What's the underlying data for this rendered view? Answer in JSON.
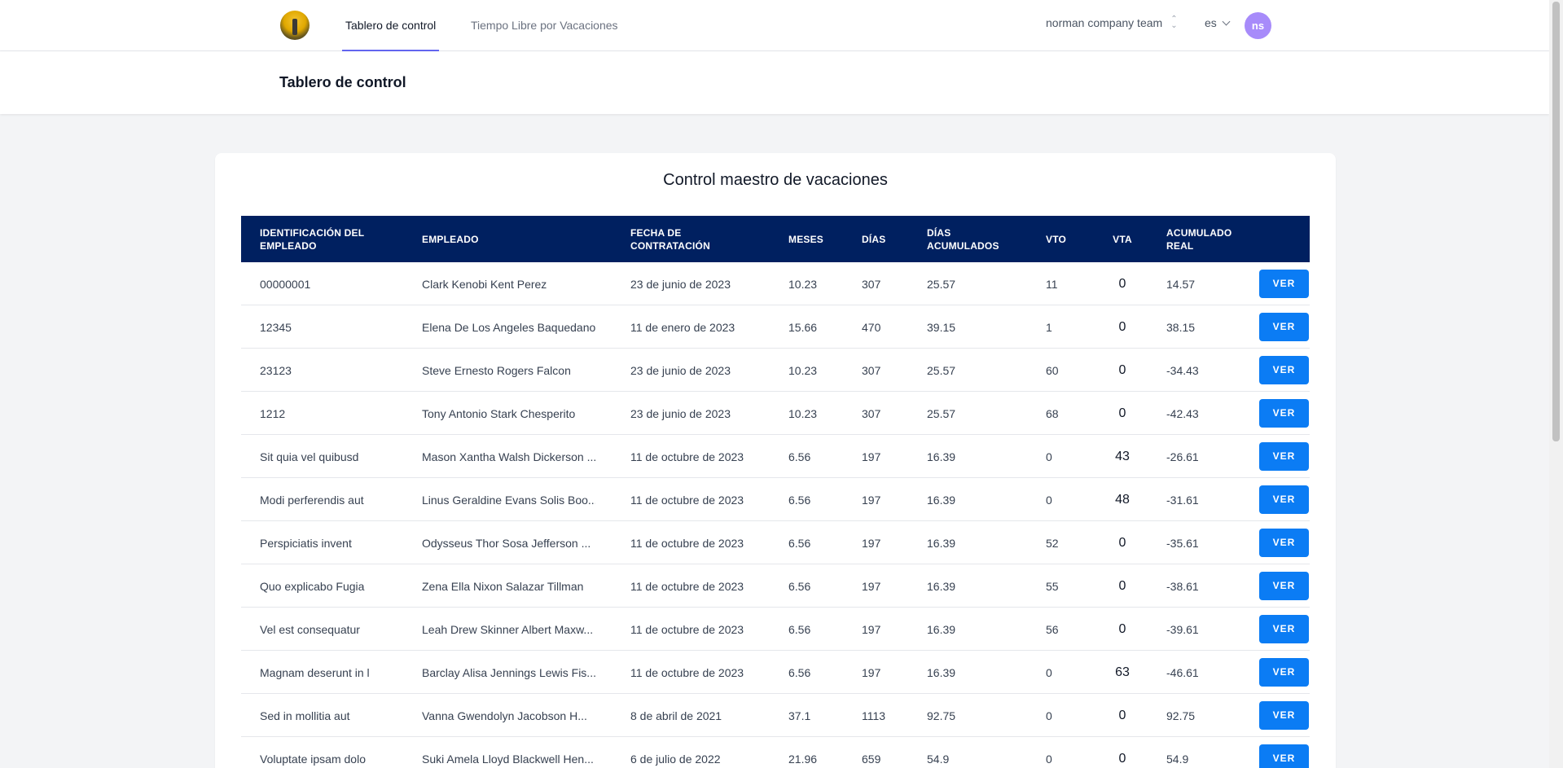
{
  "nav": {
    "tabs": [
      {
        "label": "Tablero de control",
        "active": true
      },
      {
        "label": "Tiempo Libre por Vacaciones",
        "active": false
      }
    ],
    "team": "norman company team",
    "lang": "es",
    "avatar_initials": "ns"
  },
  "header": {
    "title": "Tablero de control"
  },
  "card": {
    "title": "Control maestro de vacaciones"
  },
  "table": {
    "columns": {
      "id": "IDENTIFICACIÓN DEL EMPLEADO",
      "employee": "EMPLEADO",
      "hire_date": "FECHA DE CONTRATACIÓN",
      "months": "MESES",
      "days": "DÍAS",
      "accrued_days": "DÍAS ACUMULADOS",
      "vto": "VTO",
      "vta": "VTA",
      "real_accrued": "ACUMULADO REAL"
    },
    "action_label": "VER",
    "rows": [
      {
        "id": "00000001",
        "employee": "Clark Kenobi Kent Perez",
        "hire_date": "23 de junio de 2023",
        "months": "10.23",
        "days": "307",
        "accrued": "25.57",
        "vto": "11",
        "vta": "0",
        "real": "14.57"
      },
      {
        "id": "12345",
        "employee": "Elena De Los Angeles Baquedano",
        "hire_date": "11 de enero de 2023",
        "months": "15.66",
        "days": "470",
        "accrued": "39.15",
        "vto": "1",
        "vta": "0",
        "real": "38.15"
      },
      {
        "id": "23123",
        "employee": "Steve Ernesto Rogers Falcon",
        "hire_date": "23 de junio de 2023",
        "months": "10.23",
        "days": "307",
        "accrued": "25.57",
        "vto": "60",
        "vta": "0",
        "real": "-34.43"
      },
      {
        "id": "1212",
        "employee": "Tony Antonio Stark Chesperito",
        "hire_date": "23 de junio de 2023",
        "months": "10.23",
        "days": "307",
        "accrued": "25.57",
        "vto": "68",
        "vta": "0",
        "real": "-42.43"
      },
      {
        "id": "Sit quia vel quibusd",
        "employee": "Mason Xantha Walsh Dickerson ...",
        "hire_date": "11 de octubre de 2023",
        "months": "6.56",
        "days": "197",
        "accrued": "16.39",
        "vto": "0",
        "vta": "43",
        "real": "-26.61"
      },
      {
        "id": "Modi perferendis aut",
        "employee": "Linus Geraldine Evans Solis Boo...",
        "hire_date": "11 de octubre de 2023",
        "months": "6.56",
        "days": "197",
        "accrued": "16.39",
        "vto": "0",
        "vta": "48",
        "real": "-31.61"
      },
      {
        "id": "Perspiciatis invent",
        "employee": "Odysseus Thor Sosa Jefferson ...",
        "hire_date": "11 de octubre de 2023",
        "months": "6.56",
        "days": "197",
        "accrued": "16.39",
        "vto": "52",
        "vta": "0",
        "real": "-35.61"
      },
      {
        "id": "Quo explicabo Fugia",
        "employee": "Zena Ella Nixon Salazar Tillman",
        "hire_date": "11 de octubre de 2023",
        "months": "6.56",
        "days": "197",
        "accrued": "16.39",
        "vto": "55",
        "vta": "0",
        "real": "-38.61"
      },
      {
        "id": "Vel est consequatur",
        "employee": "Leah Drew Skinner Albert Maxw...",
        "hire_date": "11 de octubre de 2023",
        "months": "6.56",
        "days": "197",
        "accrued": "16.39",
        "vto": "56",
        "vta": "0",
        "real": "-39.61"
      },
      {
        "id": "Magnam deserunt in l",
        "employee": "Barclay Alisa Jennings Lewis Fis...",
        "hire_date": "11 de octubre de 2023",
        "months": "6.56",
        "days": "197",
        "accrued": "16.39",
        "vto": "0",
        "vta": "63",
        "real": "-46.61"
      },
      {
        "id": "Sed in mollitia aut",
        "employee": "Vanna Gwendolyn Jacobson H...",
        "hire_date": "8 de abril de 2021",
        "months": "37.1",
        "days": "1113",
        "accrued": "92.75",
        "vto": "0",
        "vta": "0",
        "real": "92.75"
      },
      {
        "id": "Voluptate ipsam dolo",
        "employee": "Suki Amela Lloyd Blackwell Hen...",
        "hire_date": "6 de julio de 2022",
        "months": "21.96",
        "days": "659",
        "accrued": "54.9",
        "vto": "0",
        "vta": "0",
        "real": "54.9"
      }
    ]
  }
}
